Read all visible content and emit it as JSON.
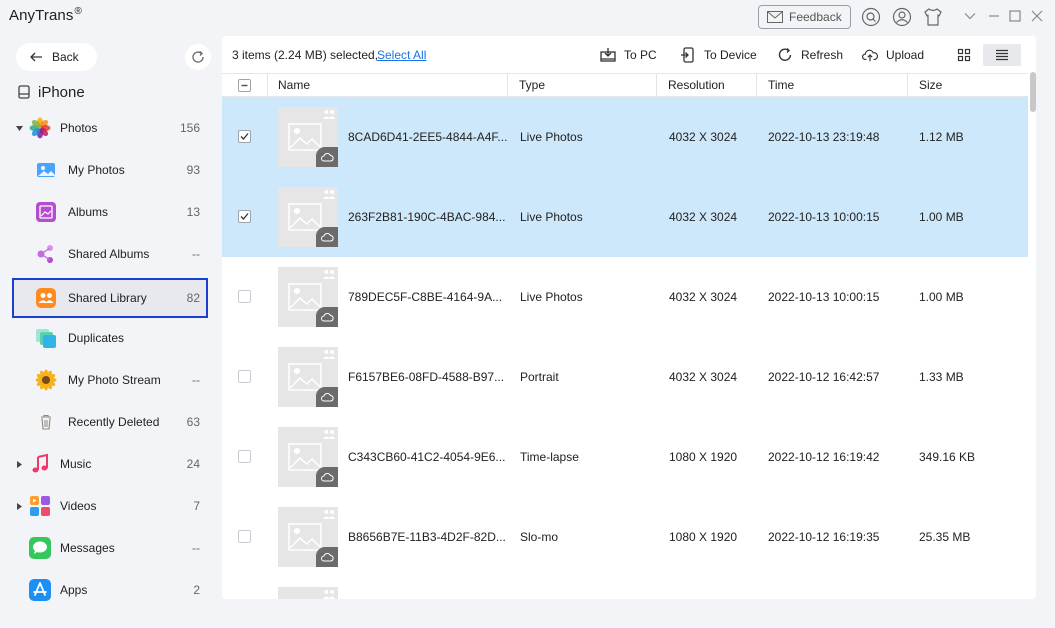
{
  "app": {
    "title": "AnyTrans",
    "reg": "®",
    "feedback_label": "Feedback"
  },
  "sidebar": {
    "back_label": "Back",
    "device_name": "iPhone",
    "items": [
      {
        "label": "Photos",
        "count": "156"
      },
      {
        "label": "My Photos",
        "count": "93"
      },
      {
        "label": "Albums",
        "count": "13"
      },
      {
        "label": "Shared Albums",
        "count": "--"
      },
      {
        "label": "Shared Library",
        "count": "82"
      },
      {
        "label": "Duplicates",
        "count": ""
      },
      {
        "label": "My Photo Stream",
        "count": "--"
      },
      {
        "label": "Recently Deleted",
        "count": "63"
      },
      {
        "label": "Music",
        "count": "24"
      },
      {
        "label": "Videos",
        "count": "7"
      },
      {
        "label": "Messages",
        "count": "--"
      },
      {
        "label": "Apps",
        "count": "2"
      }
    ]
  },
  "toolbar": {
    "selection_info": "3 items (2.24 MB) selected,",
    "select_all": "Select All",
    "to_pc": "To PC",
    "to_device": "To Device",
    "refresh": "Refresh",
    "upload": "Upload"
  },
  "table": {
    "columns": {
      "name": "Name",
      "type": "Type",
      "resolution": "Resolution",
      "time": "Time",
      "size": "Size"
    },
    "rows": [
      {
        "name": "8CAD6D41-2EE5-4844-A4F...",
        "type": "Live Photos",
        "resolution": "4032 X 3024",
        "time": "2022-10-13 23:19:48",
        "size": "1.12 MB",
        "selected": true
      },
      {
        "name": "263F2B81-190C-4BAC-984...",
        "type": "Live Photos",
        "resolution": "4032 X 3024",
        "time": "2022-10-13 10:00:15",
        "size": "1.00 MB",
        "selected": true
      },
      {
        "name": "789DEC5F-C8BE-4164-9A...",
        "type": "Live Photos",
        "resolution": "4032 X 3024",
        "time": "2022-10-13 10:00:15",
        "size": "1.00 MB",
        "selected": false
      },
      {
        "name": "F6157BE6-08FD-4588-B97...",
        "type": "Portrait",
        "resolution": "4032 X 3024",
        "time": "2022-10-12 16:42:57",
        "size": "1.33 MB",
        "selected": false
      },
      {
        "name": "C343CB60-41C2-4054-9E6...",
        "type": "Time-lapse",
        "resolution": "1080 X 1920",
        "time": "2022-10-12 16:19:42",
        "size": "349.16 KB",
        "selected": false
      },
      {
        "name": "B8656B7E-11B3-4D2F-82D...",
        "type": "Slo-mo",
        "resolution": "1080 X 1920",
        "time": "2022-10-12 16:19:35",
        "size": "25.35 MB",
        "selected": false
      }
    ]
  },
  "colors": {
    "accent": "#1a73e8",
    "selected_row": "#cde8fb",
    "selected_border": "#1b3fcf"
  }
}
